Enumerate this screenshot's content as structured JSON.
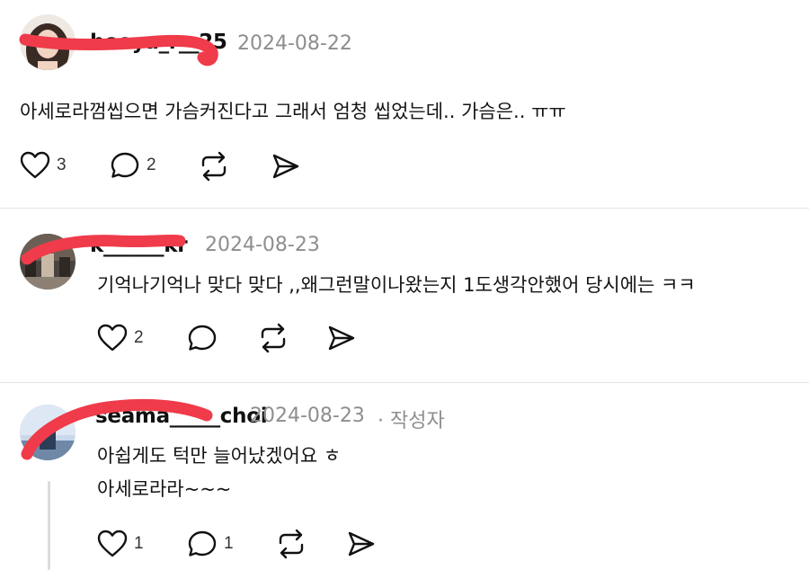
{
  "comments": [
    {
      "username": "heeya_r__25",
      "date": "2024-08-22",
      "text": "아세로라껌씹으면 가슴커진다고 그래서 엄청 씹었는데.. 가슴은.. ㅠㅠ",
      "likes": "3",
      "replies": "2"
    },
    {
      "username": "k______kr",
      "date": "2024-08-23",
      "text": "기억나기억나 맞다 맞다 ,,왜그런말이나왔는지 1도생각안했어 당시에는 ㅋㅋ",
      "likes": "2",
      "replies": ""
    },
    {
      "username": "seama_____choi",
      "date": "2024-08-23",
      "author_tag": "· 작성자",
      "text_line1": "아쉽게도 턱만 늘어났겠어요 ㅎ",
      "text_line2": "아세로라라~~~",
      "likes": "1",
      "replies": "1"
    }
  ],
  "icons": {
    "like": "heart-icon",
    "reply": "speech-bubble-icon",
    "repost": "repost-icon",
    "share": "send-icon"
  },
  "colors": {
    "redaction": "#ef3b4a",
    "date": "#8e8e8e",
    "divider": "#e3e3e3"
  }
}
